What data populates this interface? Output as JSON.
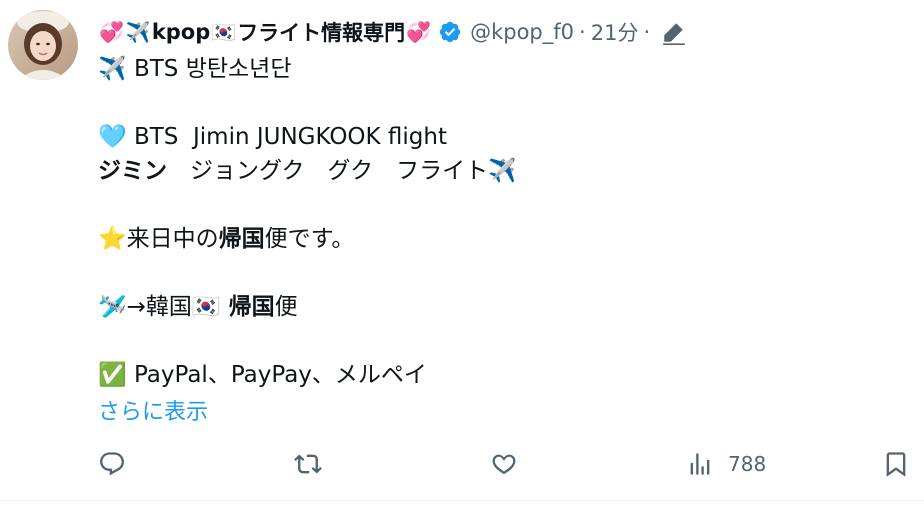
{
  "post": {
    "display_name_text": "kpop",
    "display_name_suffix": "フライト情報専門",
    "handle": "@kpop_f0",
    "separator_1": "·",
    "time": "21分",
    "separator_2": "·",
    "verified_color": "#1d9bf0",
    "emoji_heart": "💞",
    "emoji_plane": "✈️",
    "emoji_flag": "🇰🇷"
  },
  "body": {
    "line1_emoji": "✈️",
    "line1_text": " BTS 방탄소년단",
    "line2_emoji": "🩵",
    "line2_text": " BTS  Jimin JUNGKOOK flight",
    "line3_bold": "ジミン",
    "line3_rest": "　ジョングク　グク　フライト",
    "line3_emoji": "✈️",
    "line4_emoji": "⭐",
    "line4_a": "来日中の",
    "line4_bold": "帰国",
    "line4_b": "便です。",
    "line5_emoji": "🛩️",
    "line5_a": "→韓国",
    "line5_flag": "🇰🇷",
    "line5_bold": " 帰国",
    "line5_b": "便",
    "line6_emoji": "✅",
    "line6_text": " PayPal、PayPay、メルペイ"
  },
  "show_more": "さらに表示",
  "actions": {
    "views_count": "788",
    "icon_color": "#536471"
  }
}
